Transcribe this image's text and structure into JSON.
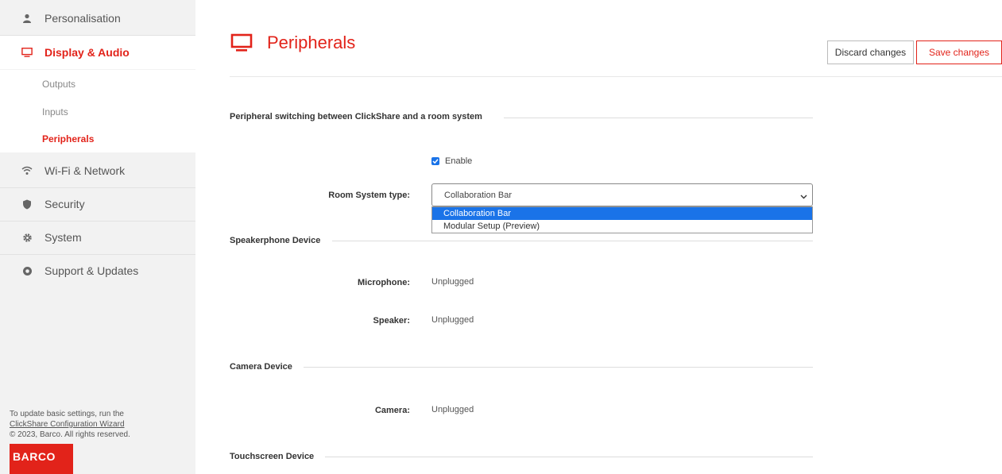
{
  "sidebar": {
    "items": [
      {
        "label": "Personalisation",
        "icon": "person-icon"
      },
      {
        "label": "Display & Audio",
        "icon": "monitor-icon"
      },
      {
        "label": "Wi-Fi & Network",
        "icon": "wifi-icon"
      },
      {
        "label": "Security",
        "icon": "shield-icon"
      },
      {
        "label": "System",
        "icon": "gear-icon"
      },
      {
        "label": "Support & Updates",
        "icon": "lifebuoy-icon"
      }
    ],
    "sub_items": [
      {
        "label": "Outputs"
      },
      {
        "label": "Inputs"
      },
      {
        "label": "Peripherals"
      }
    ],
    "footer": {
      "line1": "To update basic settings, run the",
      "link": "ClickShare Configuration Wizard",
      "copyright": "© 2023, Barco. All rights reserved.",
      "logo": "BARCO"
    }
  },
  "header": {
    "title": "Peripherals",
    "discard_label": "Discard changes",
    "save_label": "Save changes"
  },
  "peripheral_switching": {
    "section_title": "Peripheral switching between ClickShare and a room system",
    "enable_label": "Enable",
    "enable_checked": true,
    "room_system_label": "Room System type:",
    "room_system_value": "Collaboration Bar",
    "options": [
      "Collaboration Bar",
      "Modular Setup (Preview)"
    ]
  },
  "speakerphone": {
    "section_title": "Speakerphone Device",
    "microphone_label": "Microphone:",
    "microphone_value": "Unplugged",
    "speaker_label": "Speaker:",
    "speaker_value": "Unplugged"
  },
  "camera": {
    "section_title": "Camera Device",
    "camera_label": "Camera:",
    "camera_value": "Unplugged"
  },
  "touchscreen": {
    "section_title": "Touchscreen Device"
  },
  "colors": {
    "accent": "#e2231a",
    "select_blue": "#1a73e8",
    "sidebar_bg": "#f2f2f2"
  }
}
